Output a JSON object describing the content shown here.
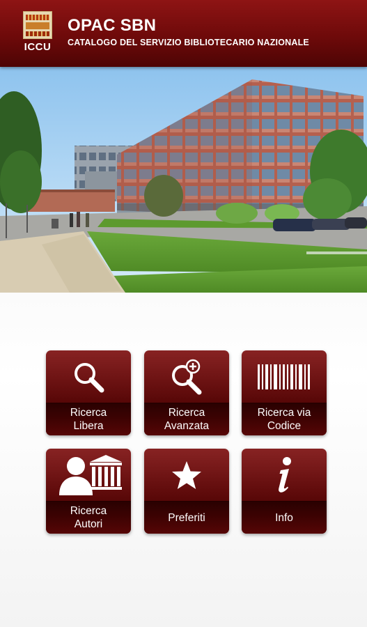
{
  "header": {
    "logo_text": "ICCU",
    "title": "OPAC SBN",
    "subtitle": "CATALOGO DEL SERVIZIO BIBLIOTECARIO NAZIONALE"
  },
  "colors": {
    "brand_primary": "#6e0a0a",
    "tile_face": "#5e0808",
    "tile_label_bg": "#3a0202",
    "text_on_brand": "#ffffff"
  },
  "menu": [
    {
      "id": "ricerca-libera",
      "label": "Ricerca\nLibera",
      "icon": "magnifier-icon"
    },
    {
      "id": "ricerca-avanzata",
      "label": "Ricerca\nAvanzata",
      "icon": "magnifier-plus-icon"
    },
    {
      "id": "ricerca-via-codice",
      "label": "Ricerca via\nCodice",
      "icon": "barcode-icon"
    },
    {
      "id": "ricerca-autori",
      "label": "Ricerca\nAutori",
      "icon": "author-library-icon"
    },
    {
      "id": "preferiti",
      "label": "Preferiti",
      "icon": "star-icon"
    },
    {
      "id": "info",
      "label": "Info",
      "icon": "info-icon"
    }
  ]
}
